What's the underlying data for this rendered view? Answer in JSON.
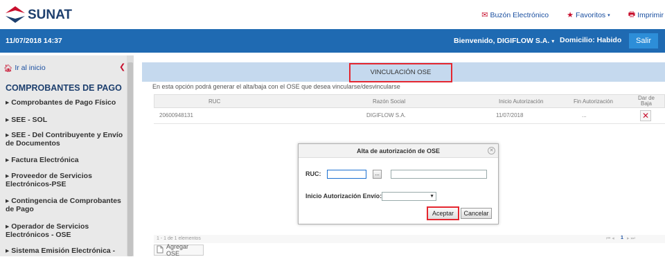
{
  "header": {
    "logo_text": "SUNAT",
    "links": [
      {
        "label": "Buzón Electrónico",
        "icon": "envelope-icon"
      },
      {
        "label": "Favoritos",
        "icon": "star-icon"
      },
      {
        "label": "Imprimir",
        "icon": "printer-icon"
      }
    ]
  },
  "bluebar": {
    "datetime": "11/07/2018 14:37",
    "welcome": "Bienvenido, DIGIFLOW S.A.",
    "domicilio": "Domicilio: Habido",
    "salir": "Salir"
  },
  "sidebar": {
    "home": "Ir al inicio",
    "title": "COMPROBANTES DE PAGO",
    "items": [
      "▸ Comprobantes de Pago Físico",
      "▸ SEE - SOL",
      "▸ SEE - Del Contribuyente y Envío de Documentos",
      "▸ Factura Electrónica",
      "▸ Proveedor de Servicios Electrónicos-PSE",
      "▸ Contingencia de Comprobantes de Pago",
      "▸ Operador de Servicios Electrónicos - OSE",
      "▸ Sistema Emisión Electrónica -"
    ]
  },
  "main": {
    "panel_title": "VINCULACIÓN OSE",
    "description": "En esta opción podrá generar el alta/baja con el OSE que desea vincularse/desvincularse",
    "columns": [
      "RUC",
      "Razón Social",
      "Inicio Autorización",
      "Fin Autorización",
      "Dar de Baja"
    ],
    "rows": [
      {
        "ruc": "20600948131",
        "razon": "DIGIFLOW S.A.",
        "inicio": "11/07/2018",
        "fin": "..."
      }
    ],
    "footer_count": "1 - 1 de 1 elementos",
    "footer_page": "1",
    "add_button": "Agregar OSE"
  },
  "dialog": {
    "title": "Alta de autorización de OSE",
    "ruc_label": "RUC:",
    "lookup_button": "...",
    "inicio_label": "Inicio Autorización Envío:",
    "accept": "Aceptar",
    "cancel": "Cancelar"
  }
}
